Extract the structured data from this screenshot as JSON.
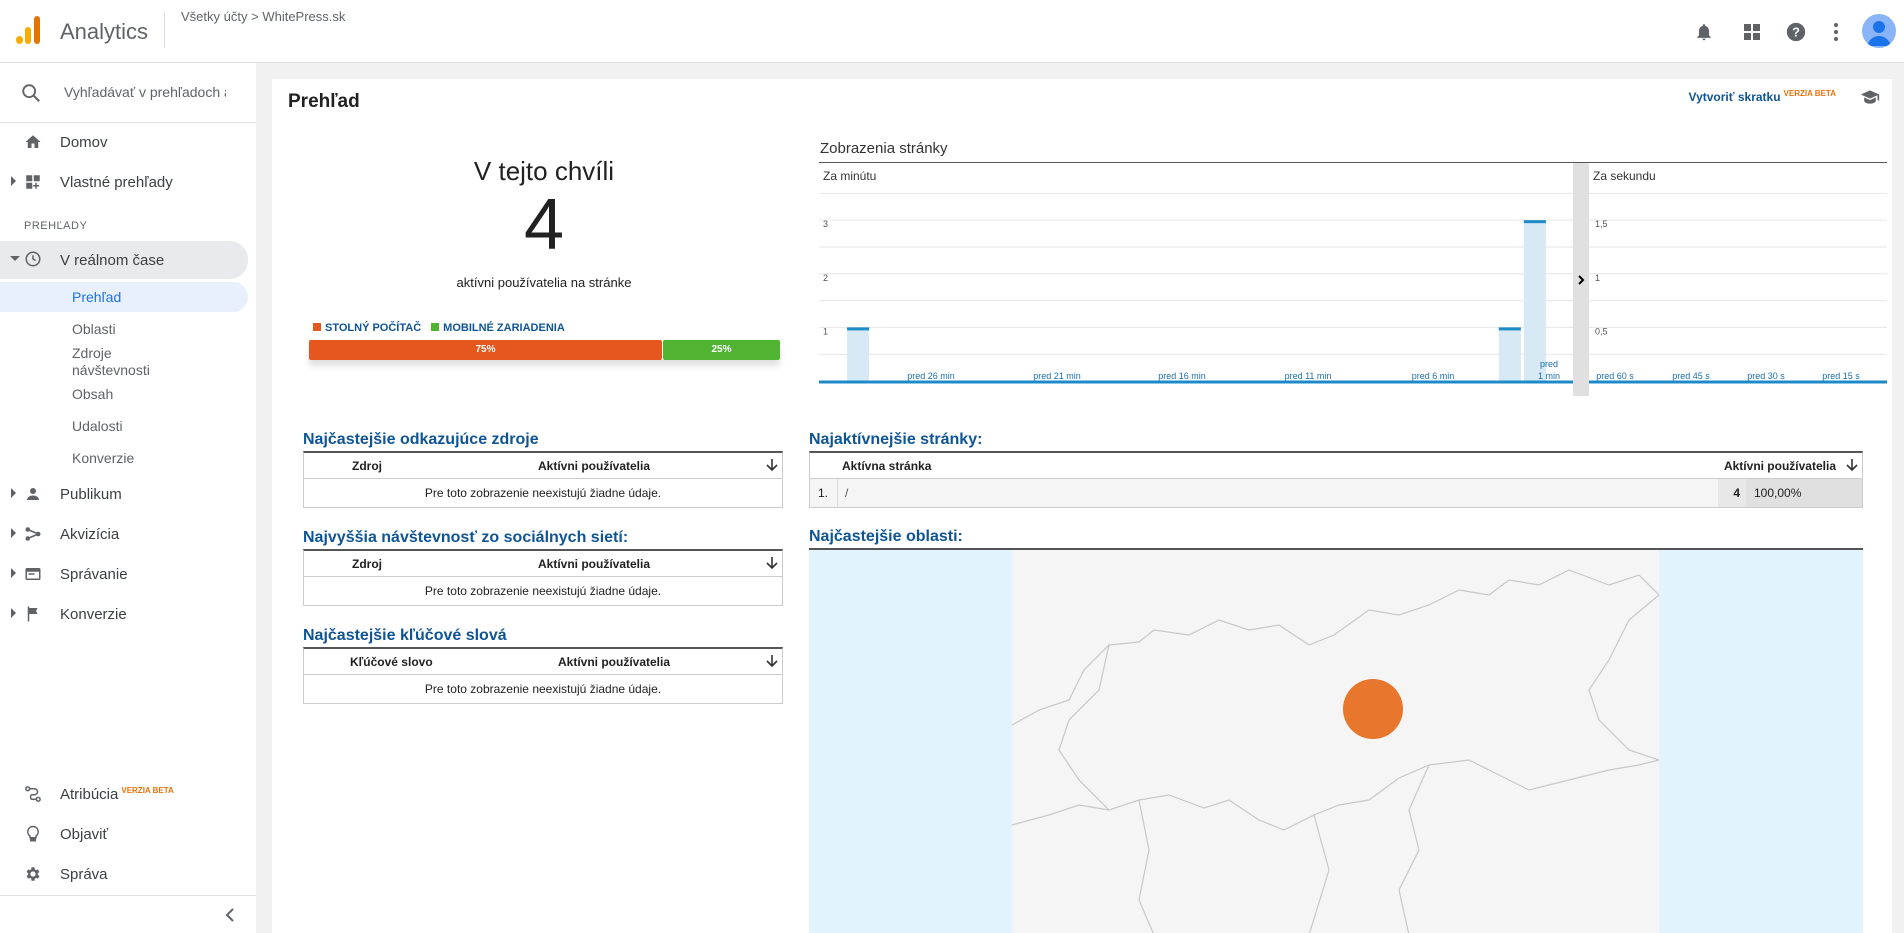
{
  "header": {
    "app_title": "Analytics",
    "breadcrumb_account": "Všetky účty",
    "breadcrumb_sep": ">",
    "breadcrumb_property": "WhitePress.sk"
  },
  "icons": {
    "bell": "bell-icon",
    "apps": "apps-icon",
    "help": "help-icon",
    "more": "more-vert-icon",
    "avatar": "account-icon"
  },
  "sidebar": {
    "search_placeholder": "Vyhľadávať v prehľadoch a p",
    "home": "Domov",
    "custom": "Vlastné prehľady",
    "section": "PREHĽADY",
    "realtime": "V reálnom čase",
    "realtime_items": [
      "Prehľad",
      "Oblasti",
      "Zdroje návštevnosti",
      "Obsah",
      "Udalosti",
      "Konverzie"
    ],
    "audience": "Publikum",
    "acquisition": "Akvizícia",
    "behavior": "Správanie",
    "conversions": "Konverzie",
    "attribution": "Atribúcia",
    "attribution_badge": "VERZIA BETA",
    "discover": "Objaviť",
    "admin": "Správa"
  },
  "main": {
    "title": "Prehľad",
    "shortcut": "Vytvoriť skratku",
    "shortcut_badge": "VERZIA BETA",
    "now_title": "V tejto chvíli",
    "active_count": "4",
    "active_sub": "aktívni používatelia na stránke",
    "legend_desktop": "STOLNÝ POČÍTAČ",
    "legend_mobile": "MOBILNÉ ZARIADENIA",
    "desktop_pct": "75%",
    "mobile_pct": "25%",
    "desktop_share": 0.75,
    "color_desktop": "#e6561f",
    "color_mobile": "#50b432"
  },
  "pageviews": {
    "title": "Zobrazenia stránky",
    "per_minute_label": "Za minútu",
    "per_second_label": "Za sekundu"
  },
  "chart_data": [
    {
      "type": "bar",
      "title": "Za minútu",
      "y_ticks": [
        "1",
        "2",
        "3"
      ],
      "ylim": [
        0,
        3.6
      ],
      "x_labels": [
        "pred 26 min",
        "pred 21 min",
        "pred 16 min",
        "pred 11 min",
        "pred 6 min",
        "pred 1 min"
      ],
      "series": [
        {
          "values": [
            0,
            1,
            0,
            0,
            0,
            0,
            0,
            0,
            0,
            0,
            0,
            0,
            0,
            0,
            0,
            0,
            0,
            0,
            0,
            0,
            0,
            0,
            0,
            0,
            0,
            0,
            0,
            1,
            3,
            0
          ]
        }
      ]
    },
    {
      "type": "bar",
      "title": "Za sekundu",
      "y_ticks": [
        "0,5",
        "1",
        "1,5"
      ],
      "ylim": [
        0,
        1.8
      ],
      "x_labels": [
        "pred 60 s",
        "pred 45 s",
        "pred 30 s",
        "pred 15 s"
      ],
      "series": [
        {
          "values": []
        }
      ]
    }
  ],
  "referrals": {
    "title": "Najčastejšie odkazujúce zdroje",
    "col1": "Zdroj",
    "col2": "Aktívni používatelia",
    "empty": "Pre toto zobrazenie neexistujú žiadne údaje."
  },
  "social": {
    "title": "Najvyššia návštevnosť zo sociálnych sietí:",
    "col1": "Zdroj",
    "col2": "Aktívni používatelia",
    "empty": "Pre toto zobrazenie neexistujú žiadne údaje."
  },
  "keywords": {
    "title": "Najčastejšie kľúčové slová",
    "col1": "Kľúčové slovo",
    "col2": "Aktívni používatelia",
    "empty": "Pre toto zobrazenie neexistujú žiadne údaje."
  },
  "pages": {
    "title": "Najaktívnejšie stránky:",
    "col1": "Aktívna stránka",
    "col2": "Aktívni používatelia",
    "rows": [
      {
        "idx": "1.",
        "page": "/",
        "count": "4",
        "pct": "100,00%"
      }
    ]
  },
  "locations": {
    "title": "Najčastejšie oblasti:"
  }
}
